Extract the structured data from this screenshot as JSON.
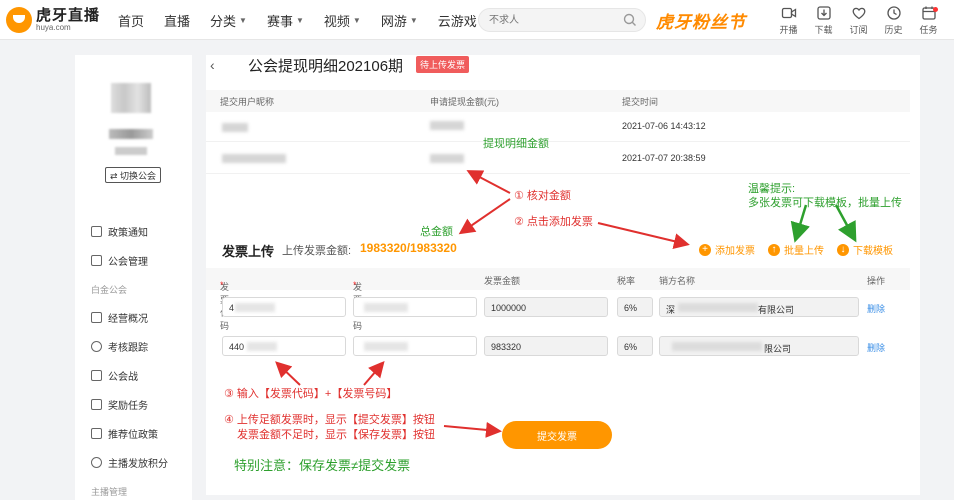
{
  "header": {
    "logo_cn": "虎牙直播",
    "logo_en": "huya.com",
    "nav": [
      {
        "label": "首页",
        "dropdown": false
      },
      {
        "label": "直播",
        "dropdown": false
      },
      {
        "label": "分类",
        "dropdown": true
      },
      {
        "label": "赛事",
        "dropdown": true
      },
      {
        "label": "视频",
        "dropdown": true
      },
      {
        "label": "网游",
        "dropdown": true
      },
      {
        "label": "云游戏",
        "dropdown": true
      }
    ],
    "search_placeholder": "不求人",
    "promo": "虎牙粉丝节",
    "tools": [
      {
        "label": "开播",
        "icon": "camera-icon"
      },
      {
        "label": "下载",
        "icon": "download-icon"
      },
      {
        "label": "订阅",
        "icon": "heart-icon"
      },
      {
        "label": "历史",
        "icon": "clock-icon"
      },
      {
        "label": "任务",
        "icon": "calendar-icon"
      }
    ]
  },
  "sidebar": {
    "switch_label": "⇄ 切换公会",
    "items_top": [
      "政策通知",
      "公会管理"
    ],
    "group_label": "白金公会",
    "items_group": [
      "经营概况",
      "考核跟踪",
      "公会战",
      "奖励任务",
      "推荐位政策",
      "主播发放积分"
    ],
    "group_label_2": "主播管理"
  },
  "page": {
    "back": "‹",
    "title": "公会提现明细202106期",
    "status_badge": "待上传发票"
  },
  "withdraw_table": {
    "headers": [
      "提交用户昵称",
      "申请提现金额(元)",
      "提交时间"
    ],
    "rows": [
      {
        "time": "2021-07-06 14:43:12"
      },
      {
        "time": "2021-07-07 20:38:59"
      }
    ]
  },
  "upload": {
    "title": "发票上传",
    "amount_label": "上传发票金额:",
    "amount_value": "1983320/1983320",
    "actions": [
      "添加发票",
      "批量上传",
      "下载模板"
    ]
  },
  "invoice_table": {
    "headers": [
      "发票代码",
      "发票号码",
      "发票金额",
      "税率",
      "销方名称",
      "操作"
    ],
    "rows": [
      {
        "code": "4",
        "number": "",
        "amount": "1000000",
        "rate": "6%",
        "seller_prefix": "深",
        "seller_suffix": "有限公司",
        "op": "删除"
      },
      {
        "code": "440",
        "number": "",
        "amount": "983320",
        "rate": "6%",
        "seller_prefix": "",
        "seller_suffix": "限公司",
        "op": "删除"
      }
    ],
    "submit_label": "提交发票"
  },
  "annotations": {
    "detail_amount": "提现明细金额",
    "step1": "① 核对金额",
    "step2": "② 点击添加发票",
    "total": "总金额",
    "tip_title": "温馨提示:",
    "tip_body": "多张发票可下载模板，批量上传",
    "step3": "③ 输入【发票代码】+【发票号码】",
    "step4_line1": "④ 上传足额发票时，显示【提交发票】按钮",
    "step4_line2": "发票金额不足时，显示【保存发票】按钮",
    "note": "特别注意：保存发票≠提交发票"
  },
  "colors": {
    "accent": "#ff9600",
    "badge": "#f05c5c",
    "annotation_red": "#e0302e",
    "annotation_green": "#2ea02e",
    "link_blue": "#3a8ee6"
  }
}
